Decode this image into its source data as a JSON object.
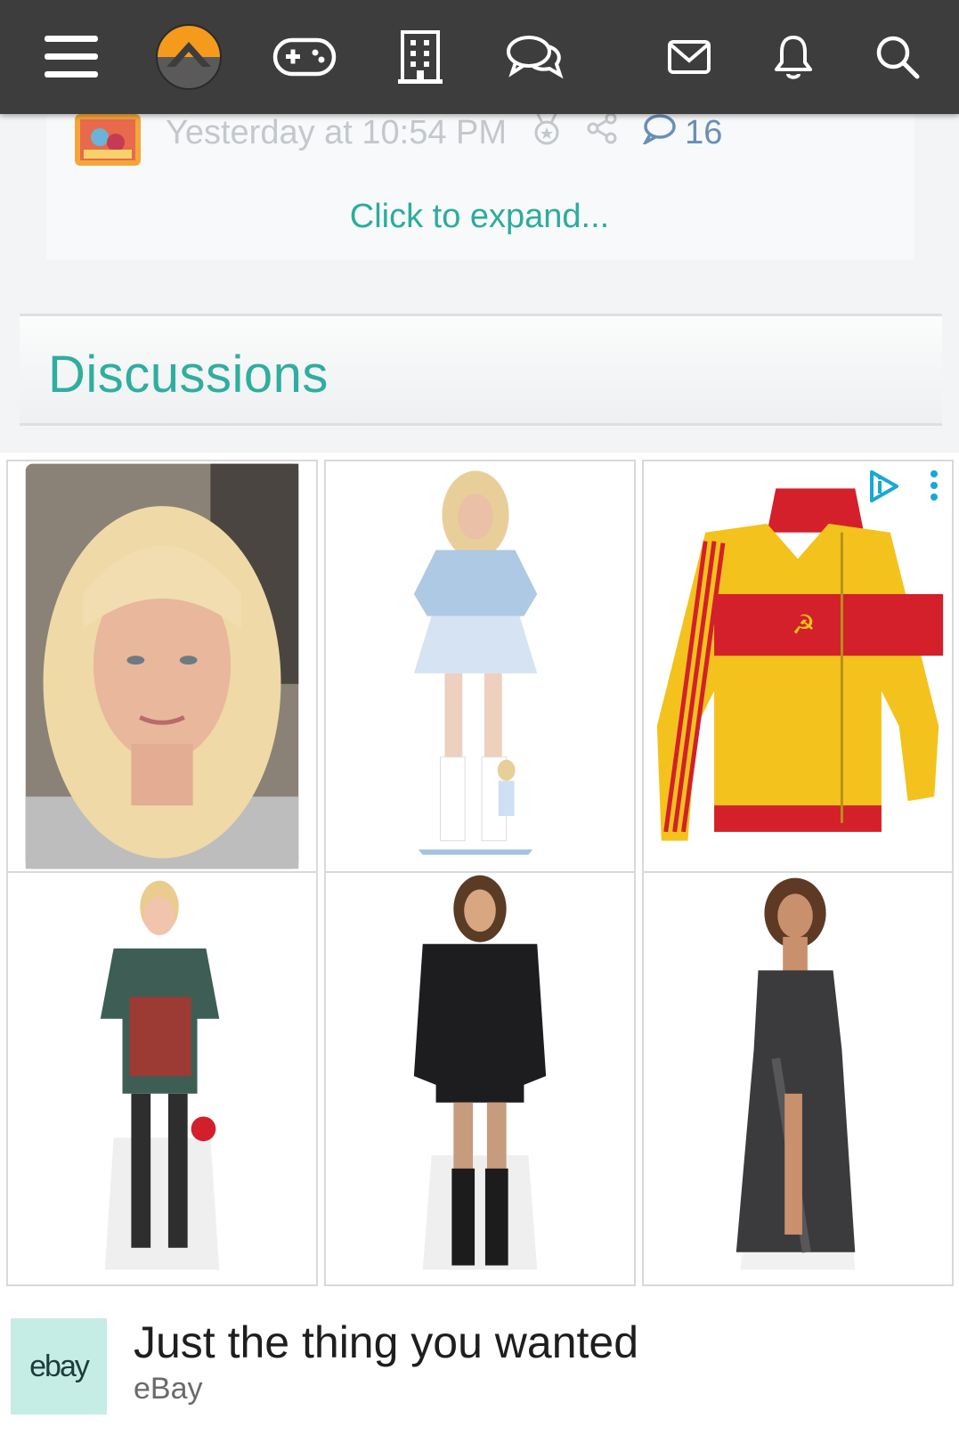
{
  "topbar": {
    "icons": [
      "menu-icon",
      "site-logo",
      "gamepad-icon",
      "building-icon",
      "chat-bubbles-icon",
      "envelope-icon",
      "bell-icon",
      "search-icon"
    ]
  },
  "post": {
    "timestamp": "Yesterday at 10:54 PM",
    "comment_count": "16",
    "expand_label": "Click to expand..."
  },
  "discussions": {
    "title": "Discussions"
  },
  "ad": {
    "headline": "Just the thing you wanted",
    "advertiser": "eBay",
    "logo_text": "ebay",
    "products": [
      "blonde-bob-wig",
      "singer-cardboard-cutout",
      "red-yellow-track-jacket",
      "celebrity-cutout-graphic-tee",
      "celebrity-cutout-black-blazer",
      "celebrity-cutout-sequin-gown"
    ]
  },
  "colors": {
    "topbar_bg": "#3d3d3d",
    "accent_teal": "#2fae9f",
    "logo_orange": "#f59a1b",
    "comment_blue": "#6a8fb5"
  }
}
